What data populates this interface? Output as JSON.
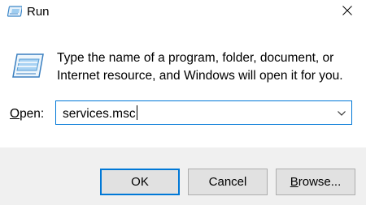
{
  "window": {
    "title": "Run",
    "icon": "run-icon",
    "close_icon": "close-icon"
  },
  "content": {
    "icon": "run-dialog-icon",
    "description": "Type the name of a program, folder, document, or Internet resource, and Windows will open it for you.",
    "open_label_accel": "O",
    "open_label_rest": "pen:",
    "open_value": "services.msc",
    "dropdown_icon": "chevron-down-icon"
  },
  "buttons": {
    "ok_label": "OK",
    "cancel_label": "Cancel",
    "browse_accel": "B",
    "browse_rest": "rowse..."
  },
  "colors": {
    "accent": "#0078d7",
    "footer_bg": "#f0f0f0",
    "button_bg": "#e1e1e1"
  }
}
